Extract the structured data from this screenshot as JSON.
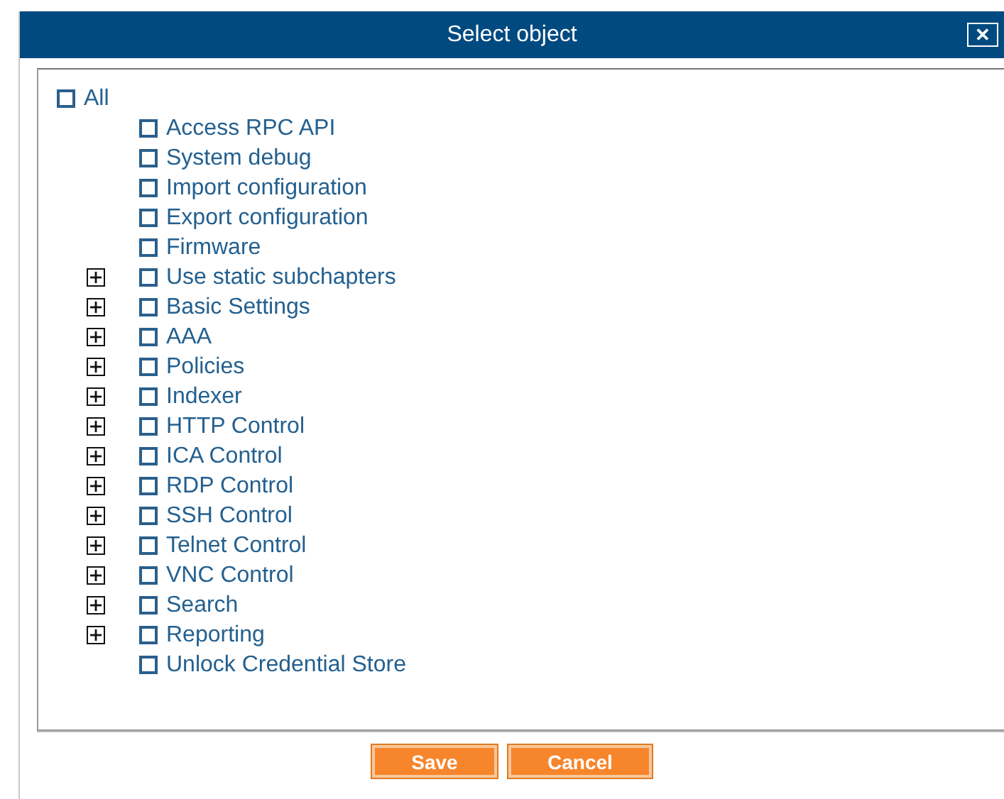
{
  "dialog": {
    "title": "Select object",
    "close": "✕"
  },
  "tree": {
    "label": "All",
    "checked": false,
    "children": [
      {
        "kind": "leaf",
        "label": "Access RPC API",
        "checked": false
      },
      {
        "kind": "leaf",
        "label": "System debug",
        "checked": false
      },
      {
        "kind": "leaf",
        "label": "Import configuration",
        "checked": false
      },
      {
        "kind": "leaf",
        "label": "Export configuration",
        "checked": false
      },
      {
        "kind": "leaf",
        "label": "Firmware",
        "checked": false
      },
      {
        "kind": "group",
        "label": "Use static subchapters",
        "checked": false,
        "expanded": false
      },
      {
        "kind": "group",
        "label": "Basic Settings",
        "checked": false,
        "expanded": false
      },
      {
        "kind": "group",
        "label": "AAA",
        "checked": false,
        "expanded": false
      },
      {
        "kind": "group",
        "label": "Policies",
        "checked": false,
        "expanded": false
      },
      {
        "kind": "group",
        "label": "Indexer",
        "checked": false,
        "expanded": false
      },
      {
        "kind": "group",
        "label": "HTTP Control",
        "checked": false,
        "expanded": false
      },
      {
        "kind": "group",
        "label": "ICA Control",
        "checked": false,
        "expanded": false
      },
      {
        "kind": "group",
        "label": "RDP Control",
        "checked": false,
        "expanded": false
      },
      {
        "kind": "group",
        "label": "SSH Control",
        "checked": false,
        "expanded": false
      },
      {
        "kind": "group",
        "label": "Telnet Control",
        "checked": false,
        "expanded": false
      },
      {
        "kind": "group",
        "label": "VNC Control",
        "checked": false,
        "expanded": false
      },
      {
        "kind": "group",
        "label": "Search",
        "checked": false,
        "expanded": false
      },
      {
        "kind": "group",
        "label": "Reporting",
        "checked": false,
        "expanded": false
      },
      {
        "kind": "leaf",
        "label": "Unlock Credential Store",
        "checked": false
      }
    ]
  },
  "buttons": [
    "Save",
    "Cancel"
  ]
}
